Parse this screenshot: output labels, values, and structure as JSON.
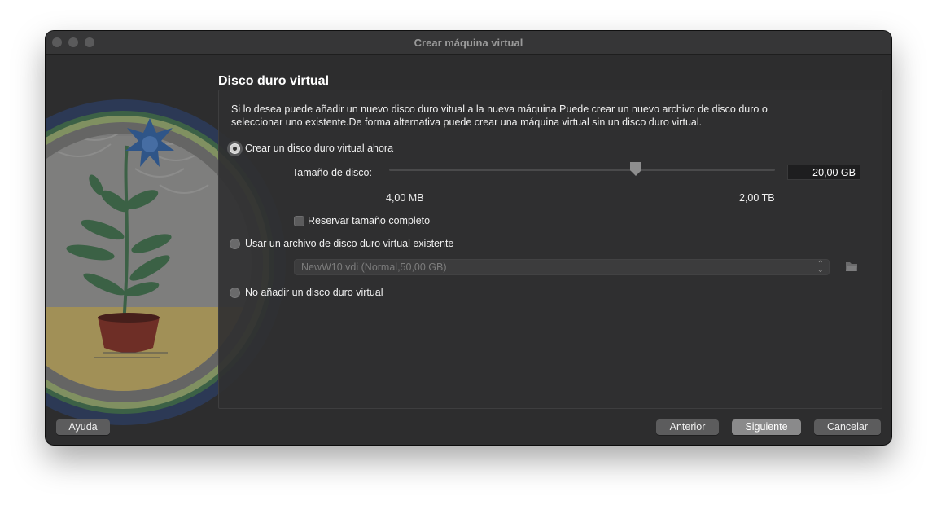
{
  "window": {
    "title": "Crear máquina virtual"
  },
  "page": {
    "heading": "Disco duro virtual",
    "description": "Si lo desea puede añadir un nuevo disco duro vitual a la nueva máquina.Puede crear un nuevo archivo de disco duro o seleccionar uno existente.De forma alternativa puede crear una máquina virtual sin un disco duro virtual."
  },
  "options": {
    "create_label": "Crear un disco duro virtual ahora",
    "existing_label": "Usar un archivo de disco duro virtual existente",
    "none_label": "No añadir un disco duro virtual",
    "selected": "create"
  },
  "disk_size": {
    "label": "Tamaño de disco:",
    "value": "20,00 GB",
    "min_label": "4,00 MB",
    "max_label": "2,00 TB",
    "slider_fraction": 0.64
  },
  "reserve": {
    "label": "Reservar tamaño completo",
    "checked": false
  },
  "existing_disk": {
    "selected": "NewW10.vdi (Normal,50,00 GB)"
  },
  "buttons": {
    "help": "Ayuda",
    "back": "Anterior",
    "next": "Siguiente",
    "cancel": "Cancelar"
  },
  "icons": {
    "window_close": "close-icon",
    "window_minimize": "minimize-icon",
    "window_zoom": "zoom-icon",
    "select_arrows": "updown-chevron-icon",
    "choose_file": "folder-open-icon"
  },
  "colors": {
    "window_bg": "#2d2d2e",
    "primary_button": "#8a8a8b",
    "button": "#5c5c5d",
    "text": "#f0f0f0"
  }
}
